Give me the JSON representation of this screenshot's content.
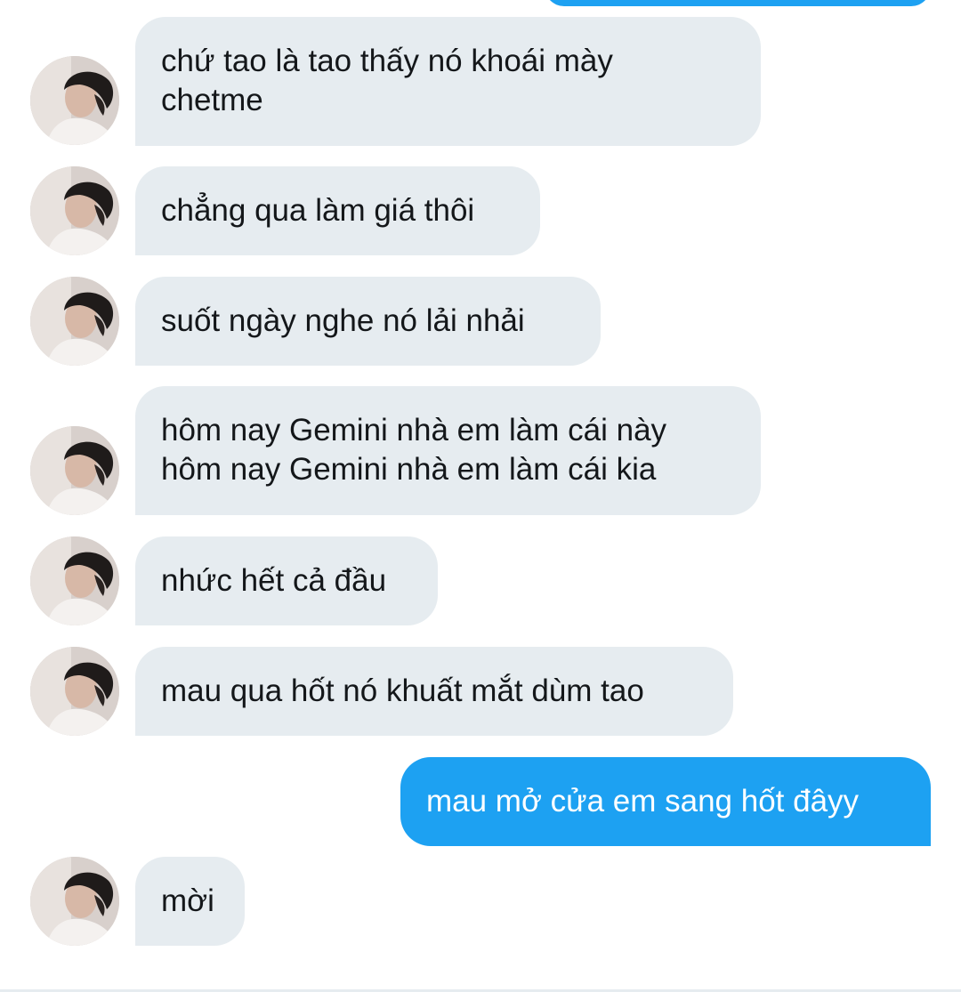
{
  "conversation": {
    "messages": [
      {
        "sender": "them",
        "text": "chứ tao là tao thấy nó khoái mày\nchetme",
        "avatar": "profile-photo"
      },
      {
        "sender": "them",
        "text": "chẳng qua làm giá thôi",
        "avatar": "profile-photo"
      },
      {
        "sender": "them",
        "text": "suốt ngày nghe nó lải nhải",
        "avatar": "profile-photo"
      },
      {
        "sender": "them",
        "text": "hôm nay Gemini nhà em làm cái này\nhôm nay Gemini nhà em làm cái kia",
        "avatar": "profile-photo"
      },
      {
        "sender": "them",
        "text": "nhức hết cả đầu",
        "avatar": "profile-photo"
      },
      {
        "sender": "them",
        "text": "mau qua hốt nó khuất mắt dùm tao",
        "avatar": "profile-photo"
      },
      {
        "sender": "me",
        "text": "mau mở cửa em sang hốt đâyy"
      },
      {
        "sender": "them",
        "text": "mời",
        "avatar": "profile-photo"
      }
    ]
  },
  "colors": {
    "incoming_bubble": "#e6ecf0",
    "outgoing_bubble": "#1da1f2",
    "incoming_text": "#14171a",
    "outgoing_text": "#ffffff"
  }
}
